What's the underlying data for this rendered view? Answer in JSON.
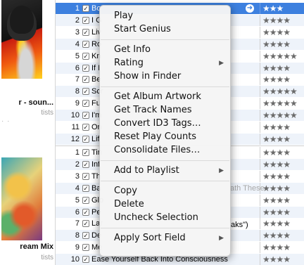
{
  "albums": [
    {
      "title": "r - soun...",
      "sub": "tists",
      "dots": "· ·"
    },
    {
      "title": "ream Mix",
      "sub": "tists",
      "dots": ""
    }
  ],
  "tracks": [
    {
      "num": "1",
      "title": "Bo",
      "rating": "★★★",
      "sel": true
    },
    {
      "num": "2",
      "title": "I G",
      "rating": "★★★★"
    },
    {
      "num": "3",
      "title": "Liv",
      "rating": "★★★★"
    },
    {
      "num": "4",
      "title": "Ro",
      "rating": "★★★★"
    },
    {
      "num": "5",
      "title": "Kn",
      "rating": "★★★★★"
    },
    {
      "num": "6",
      "title": "If I",
      "rating": "★★★★"
    },
    {
      "num": "7",
      "title": "Be",
      "rating": "★★★★"
    },
    {
      "num": "8",
      "title": "Scr",
      "rating": "★★★★★"
    },
    {
      "num": "9",
      "title": "Fu",
      "rating": "★★★★★"
    },
    {
      "num": "10",
      "title": "I'm",
      "rating": "★★★★★"
    },
    {
      "num": "11",
      "title": "On",
      "rating": "★★★★"
    },
    {
      "num": "12",
      "title": "Lif",
      "rating": "★★★★"
    },
    {
      "num": "1",
      "title": "Tin",
      "rating": "★★★★"
    },
    {
      "num": "2",
      "title": "Inf",
      "rating": "★★★★"
    },
    {
      "num": "3",
      "title": "Th",
      "rating": "★★★★"
    },
    {
      "num": "4",
      "title": "Ba",
      "rating": "★★★★"
    },
    {
      "num": "5",
      "title": "Glo",
      "rating": "★★★★"
    },
    {
      "num": "6",
      "title": "Pe",
      "rating": "★★★★"
    },
    {
      "num": "7",
      "title": "Lar",
      "rating": "★★★★"
    },
    {
      "num": "8",
      "title": "De",
      "rating": "★★★★"
    },
    {
      "num": "9",
      "title": "Me",
      "rating": "★★★★"
    },
    {
      "num": "10",
      "title": "Ease Yourself Back Into Consciousness",
      "rating": "★★★★"
    }
  ],
  "extras": {
    "row15": "ath These",
    "row19": "aks\")"
  },
  "menu": {
    "items": [
      {
        "label": "Play"
      },
      {
        "label": "Start Genius"
      },
      {
        "sep": true
      },
      {
        "label": "Get Info"
      },
      {
        "label": "Rating",
        "submenu": true
      },
      {
        "label": "Show in Finder"
      },
      {
        "sep": true
      },
      {
        "label": "Get Album Artwork"
      },
      {
        "label": "Get Track Names"
      },
      {
        "label": "Convert ID3 Tags…"
      },
      {
        "label": "Reset Play Counts"
      },
      {
        "label": "Consolidate Files…"
      },
      {
        "sep": true
      },
      {
        "label": "Add to Playlist",
        "submenu": true
      },
      {
        "sep": true
      },
      {
        "label": "Copy"
      },
      {
        "label": "Delete"
      },
      {
        "label": "Uncheck Selection"
      },
      {
        "sep": true
      },
      {
        "label": "Apply Sort Field",
        "submenu": true
      }
    ],
    "submenu_glyph": "▶"
  },
  "checkmark": "✓",
  "row_arrow": "➜"
}
